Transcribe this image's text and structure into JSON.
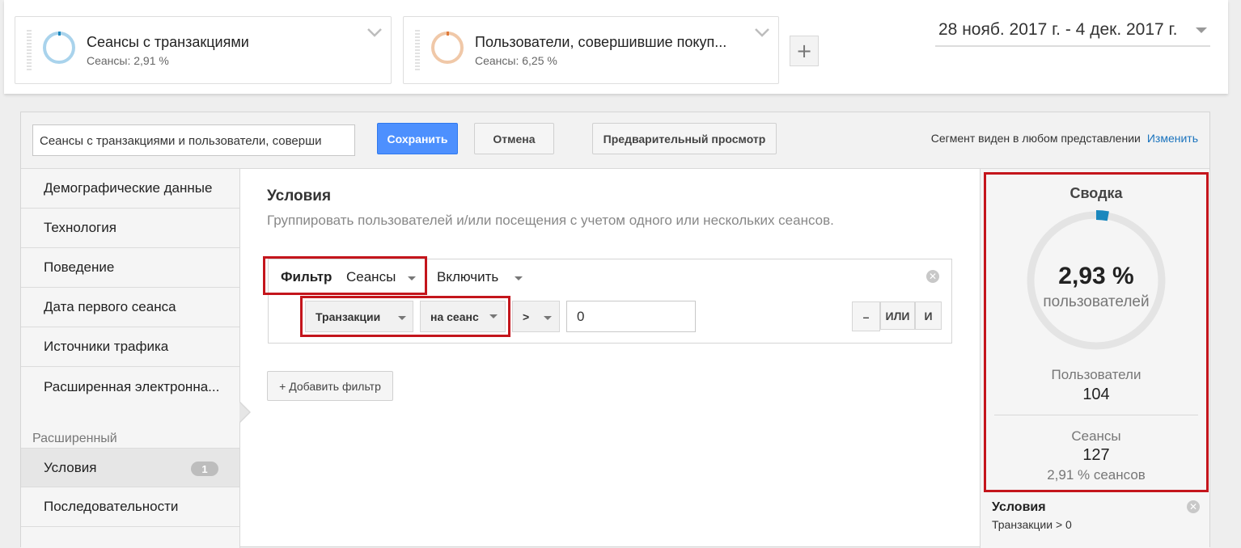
{
  "segments": [
    {
      "title": "Сеансы с транзакциями",
      "subtitle": "Сеансы: 2,91 %",
      "color": "#a9d3ec"
    },
    {
      "title": "Пользователи, совершившие покуп...",
      "subtitle": "Сеансы: 6,25 %",
      "color": "#f0c8a8"
    }
  ],
  "add_segment_label": "+",
  "date_range": "28 нояб. 2017 г. - 4 дек. 2017 г.",
  "editor": {
    "segment_name": "Сеансы с транзакциями и пользователи, соверши",
    "save_label": "Сохранить",
    "cancel_label": "Отмена",
    "preview_label": "Предварительный просмотр",
    "visibility_text": "Сегмент виден в любом представлении",
    "change_label": "Изменить"
  },
  "sidenav": {
    "items": [
      "Демографические данные",
      "Технология",
      "Поведение",
      "Дата первого сеанса",
      "Источники трафика",
      "Расширенная электронна..."
    ],
    "advanced_heading": "Расширенный",
    "conditions_label": "Условия",
    "conditions_count": "1",
    "sequences_label": "Последовательности"
  },
  "main": {
    "title": "Условия",
    "subtitle": "Группировать пользователей и/или посещения с учетом одного или нескольких сеансов.",
    "filter_label": "Фильтр",
    "scope_value": "Сеансы",
    "include_value": "Включить",
    "dimension_value": "Транзакции",
    "per_value": "на сеанс",
    "operator_value": ">",
    "input_value": "0",
    "minus_label": "–",
    "or_label": "ИЛИ",
    "and_label": "И",
    "add_filter_label": "+ Добавить фильтр"
  },
  "summary": {
    "title": "Сводка",
    "percent": "2,93 %",
    "percent_label": "пользователей",
    "percent_fraction": 0.0293,
    "users_label": "Пользователи",
    "users_value": "104",
    "sessions_label": "Сеансы",
    "sessions_value": "127",
    "sessions_pct": "2,91 % сеансов",
    "accent_color": "#1a87bd",
    "conditions_title": "Условия",
    "conditions_text": "Транзакции > 0"
  },
  "colors": {
    "highlight": "#c4151c",
    "primary_button": "#4d90fe",
    "link": "#1a73bd"
  }
}
